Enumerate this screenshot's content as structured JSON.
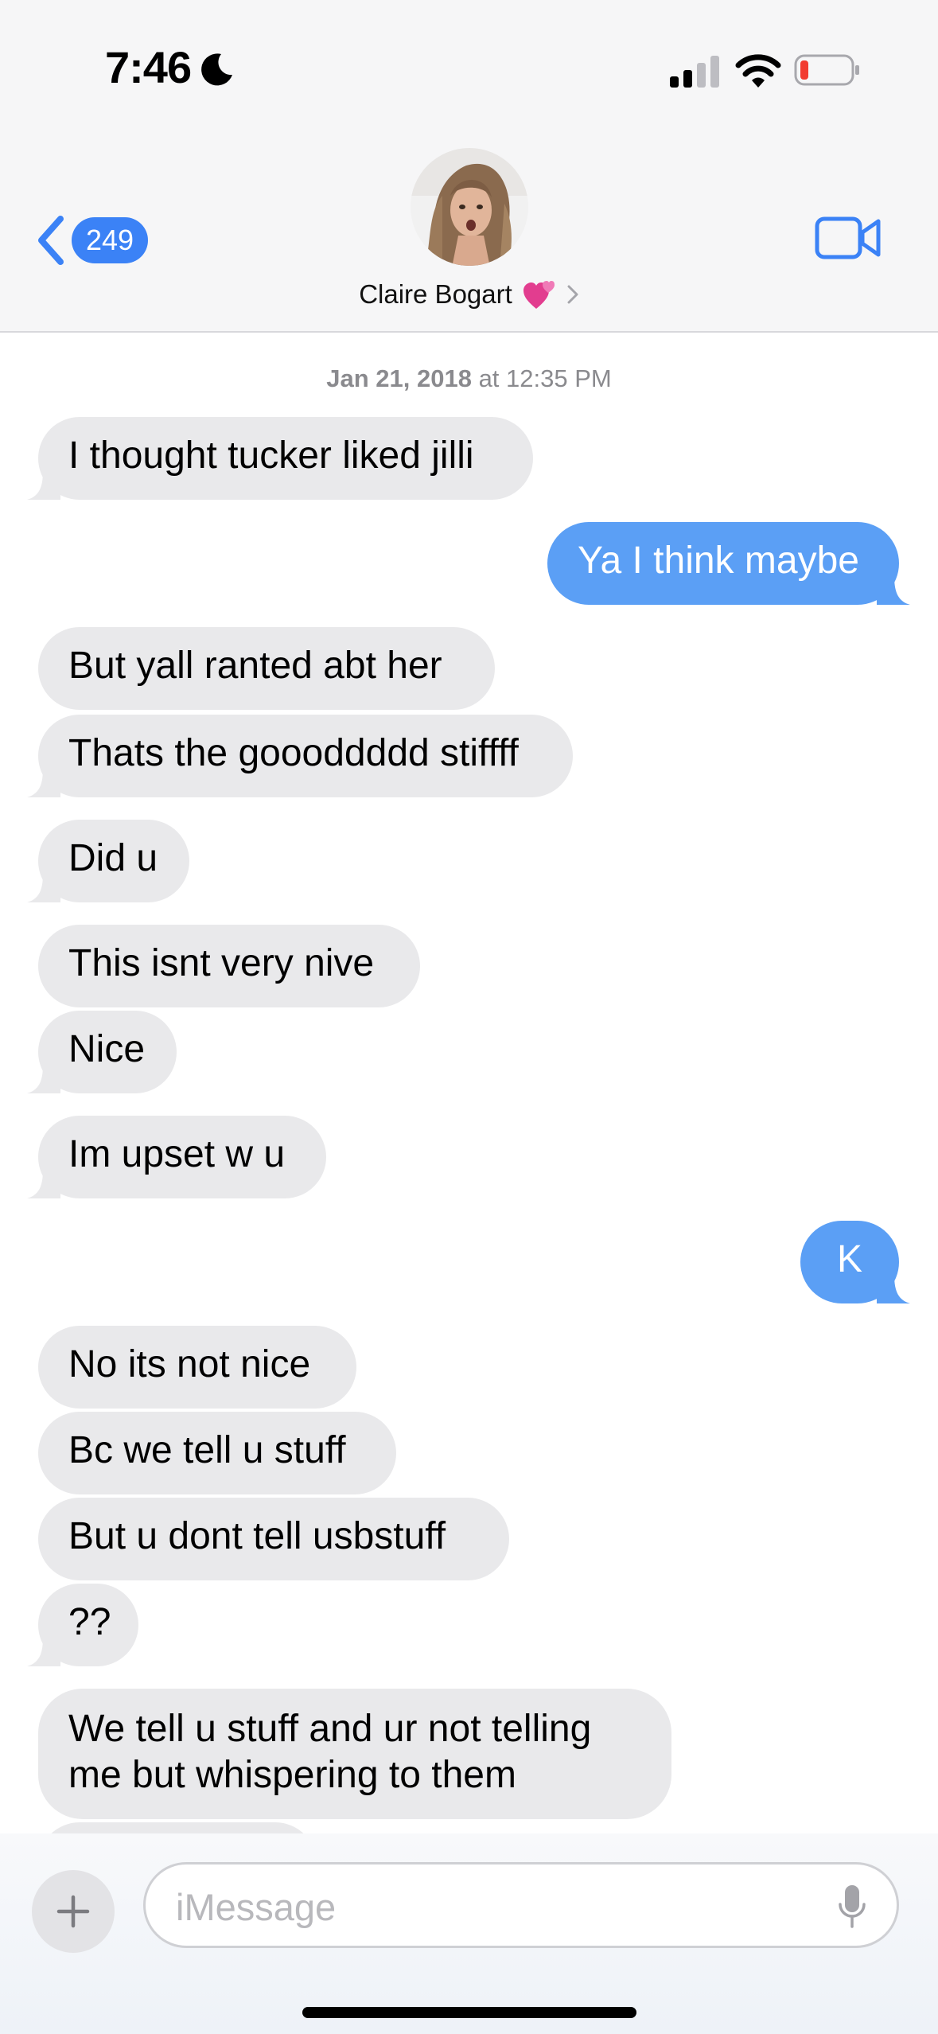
{
  "status_bar": {
    "time": "7:46",
    "icons": [
      "moon-icon",
      "signal-icon",
      "wifi-icon",
      "battery-icon"
    ]
  },
  "header": {
    "back_count": "249",
    "contact_name": "Claire Bogart",
    "icons": [
      "chevron-left-icon",
      "two-hearts-icon",
      "chevron-right-icon",
      "video-camera-icon"
    ]
  },
  "thread": {
    "timestamp_date": "Jan 21, 2018",
    "timestamp_time": " at 12:35 PM",
    "messages": [
      {
        "from": "them",
        "text": "I thought tucker liked jilli"
      },
      {
        "from": "me",
        "text": "Ya I think maybe"
      },
      {
        "from": "them",
        "text": "But yall ranted abt her"
      },
      {
        "from": "them",
        "text": "Thats the goooddddd stiffff"
      },
      {
        "from": "them",
        "text": "Did u"
      },
      {
        "from": "them",
        "text": "This isnt very nive"
      },
      {
        "from": "them",
        "text": "Nice"
      },
      {
        "from": "them",
        "text": "Im upset w u"
      },
      {
        "from": "me",
        "text": "K"
      },
      {
        "from": "them",
        "text": "No its not nice"
      },
      {
        "from": "them",
        "text": "Bc we tell u stuff"
      },
      {
        "from": "them",
        "text": "But u dont tell usbstuff"
      },
      {
        "from": "them",
        "text": "??"
      },
      {
        "from": "them",
        "text": "We tell u stuff and ur not telling me but whispering to them"
      }
    ]
  },
  "composer": {
    "placeholder": "iMessage",
    "icons": [
      "plus-icon",
      "microphone-icon"
    ]
  },
  "colors": {
    "sent_bubble": "#5b9ff5",
    "received_bubble": "#e9e9eb",
    "accent": "#3b82f6"
  }
}
